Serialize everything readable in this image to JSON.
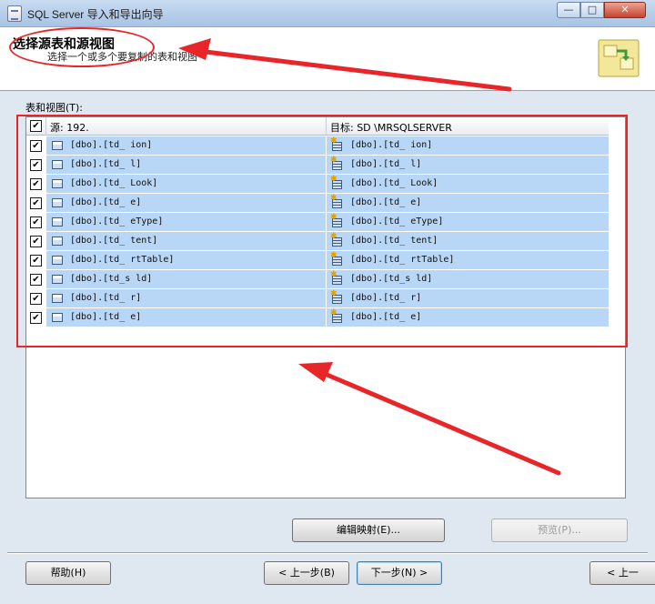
{
  "window": {
    "title": "SQL Server 导入和导出向导",
    "minimize_label": "—",
    "maximize_label": "□",
    "close_label": "✕"
  },
  "header": {
    "title": "选择源表和源视图",
    "subtitle": "选择一个或多个要复制的表和视图"
  },
  "tables_label": "表和视图(T):",
  "grid": {
    "source_header": "源: 192.",
    "dest_header": "目标: SD                    \\MRSQLSERVER",
    "rows": [
      {
        "source": "[dbo].[td_        ion]",
        "dest": "[dbo].[td_        ion]"
      },
      {
        "source": "[dbo].[td_     l]",
        "dest": "[dbo].[td_     l]"
      },
      {
        "source": "[dbo].[td_     Look]",
        "dest": "[dbo].[td_     Look]"
      },
      {
        "source": "[dbo].[td_     e]",
        "dest": "[dbo].[td_     e]"
      },
      {
        "source": "[dbo].[td_     eType]",
        "dest": "[dbo].[td_     eType]"
      },
      {
        "source": "[dbo].[td_      tent]",
        "dest": "[dbo].[td_      tent]"
      },
      {
        "source": "[dbo].[td_     rtTable]",
        "dest": "[dbo].[td_     rtTable]"
      },
      {
        "source": "[dbo].[td_s     ld]",
        "dest": "[dbo].[td_s     ld]"
      },
      {
        "source": "[dbo].[td_     r]",
        "dest": "[dbo].[td_     r]"
      },
      {
        "source": "[dbo].[td_     e]",
        "dest": "[dbo].[td_     e]"
      }
    ]
  },
  "buttons": {
    "edit_mapping": "编辑映射(E)...",
    "preview": "预览(P)...",
    "help": "帮助(H)",
    "back": "< 上一步(B)",
    "next": "下一步(N) >",
    "back_partial": "< 上一"
  },
  "colors": {
    "selection": "#b8d6f5",
    "annotation": "#e8262a"
  }
}
